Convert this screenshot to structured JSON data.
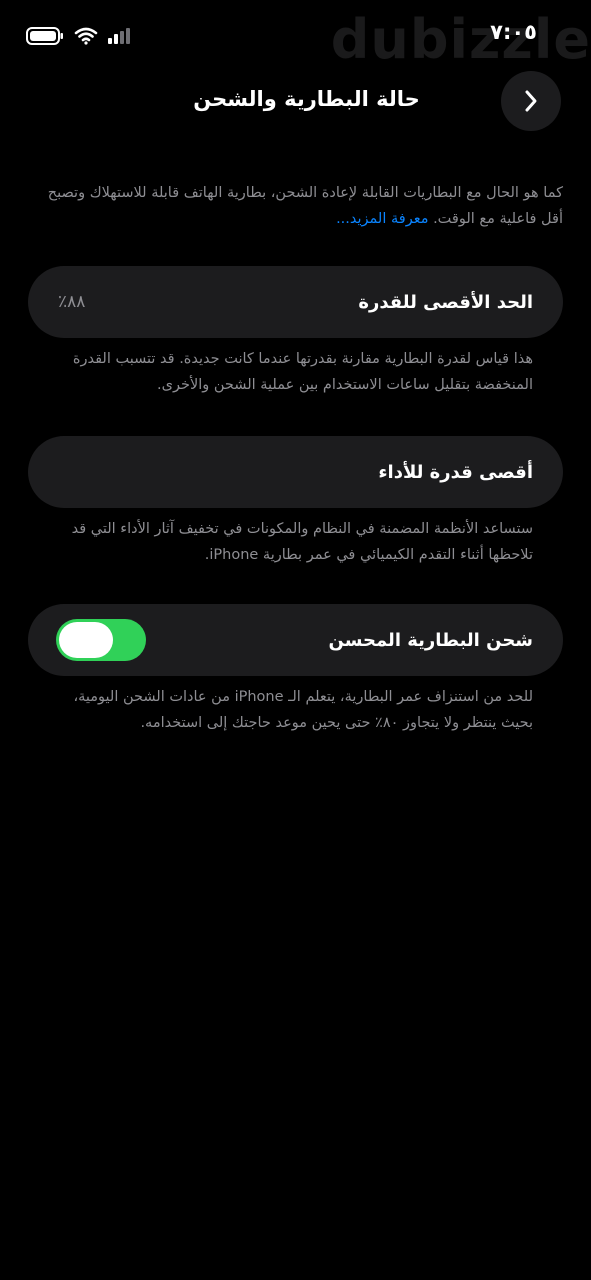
{
  "status_bar": {
    "time": "٧:٠٥",
    "watermark": "dubizzle"
  },
  "header": {
    "title": "حالة البطارية والشحن",
    "back_icon": "chevron-right-icon"
  },
  "intro": {
    "text": "كما هو الحال مع البطاريات القابلة لإعادة الشحن، بطارية الهاتف قابلة للاستهلاك وتصبح أقل فاعلية مع الوقت.",
    "link": "معرفة المزيد..."
  },
  "max_capacity": {
    "label": "الحد الأقصى للقدرة",
    "value": "٨٨٪",
    "description": "هذا قياس لقدرة البطارية مقارنة بقدرتها عندما كانت جديدة. قد تتسبب القدرة المنخفضة بتقليل ساعات الاستخدام بين عملية الشحن والأخرى."
  },
  "peak_performance": {
    "label": "أقصى قدرة للأداء",
    "description": "ستساعد الأنظمة المضمنة في النظام والمكونات في تخفيف آثار الأداء التي قد تلاحظها أثناء التقدم الكيميائي في عمر بطارية iPhone."
  },
  "optimized_charging": {
    "label": "شحن البطارية المحسن",
    "enabled": true,
    "description": "للحد من استنزاف عمر البطارية، يتعلم الـ iPhone من عادات الشحن اليومية، بحيث ينتظر ولا يتجاوز ٨٠٪ حتى يحين موعد حاجتك إلى استخدامه."
  },
  "colors": {
    "background": "#000000",
    "card": "#1c1c1e",
    "toggle_on": "#30d158",
    "link": "#0a84ff",
    "secondary_text": "#8e8e93"
  }
}
